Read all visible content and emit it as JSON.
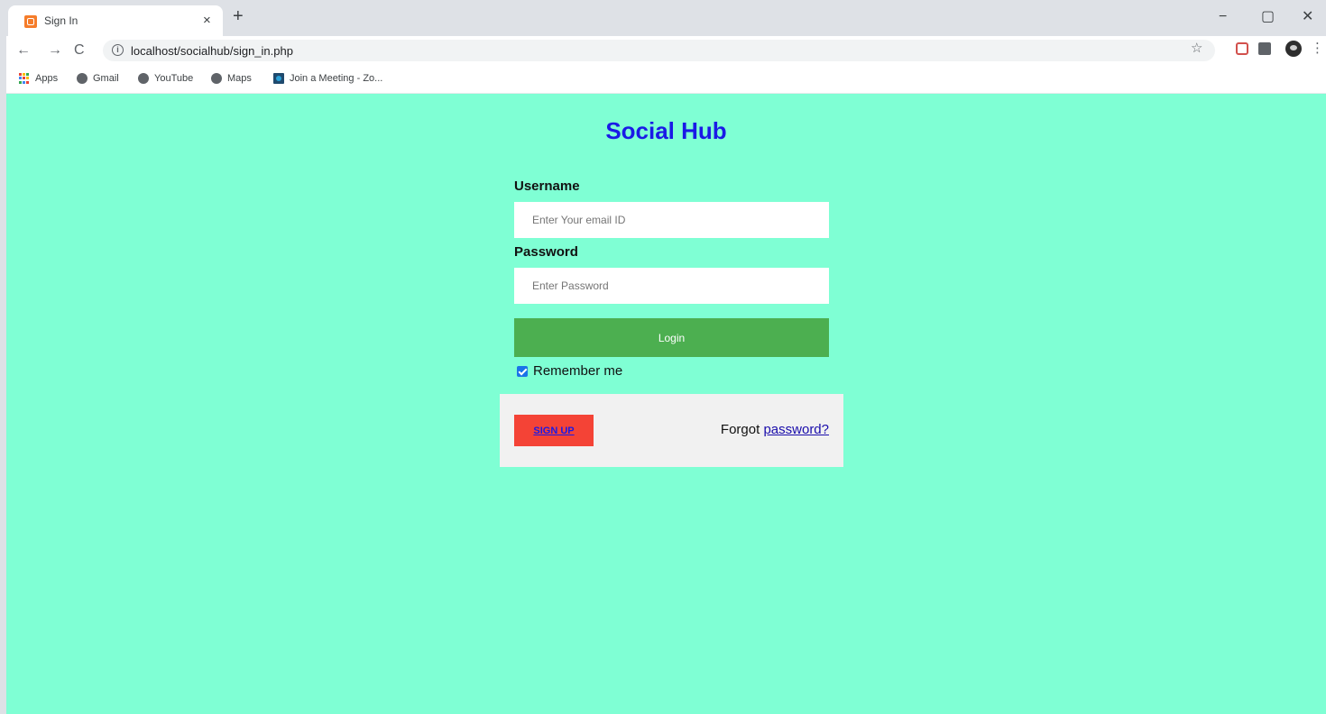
{
  "browser": {
    "tab": {
      "title": "Sign In",
      "close_glyph": "×"
    },
    "new_tab_glyph": "+",
    "window_controls": {
      "minimize": "−",
      "maximize": "▢",
      "close": "✕"
    },
    "nav": {
      "back": "←",
      "forward": "→",
      "reload": "C"
    },
    "url": "localhost/socialhub/sign_in.php",
    "star": "☆",
    "menu": "⋮",
    "bookmarks": [
      {
        "label": "Apps",
        "icon": "apps-grid-icon"
      },
      {
        "label": "Gmail",
        "icon": "globe-icon"
      },
      {
        "label": "YouTube",
        "icon": "globe-icon"
      },
      {
        "label": "Maps",
        "icon": "globe-icon"
      },
      {
        "label": "Join a Meeting - Zo...",
        "icon": "zoom-icon"
      }
    ]
  },
  "page": {
    "title": "Social Hub",
    "background_color": "#7fffd4",
    "username": {
      "label": "Username",
      "placeholder": "Enter Your email ID",
      "value": ""
    },
    "password": {
      "label": "Password",
      "placeholder": "Enter Password",
      "value": ""
    },
    "login_label": "Login",
    "remember": {
      "label": "Remember me",
      "checked": true
    },
    "signup_label": "SIGN UP",
    "forgot_prefix": "Forgot",
    "forgot_link": "password?"
  }
}
